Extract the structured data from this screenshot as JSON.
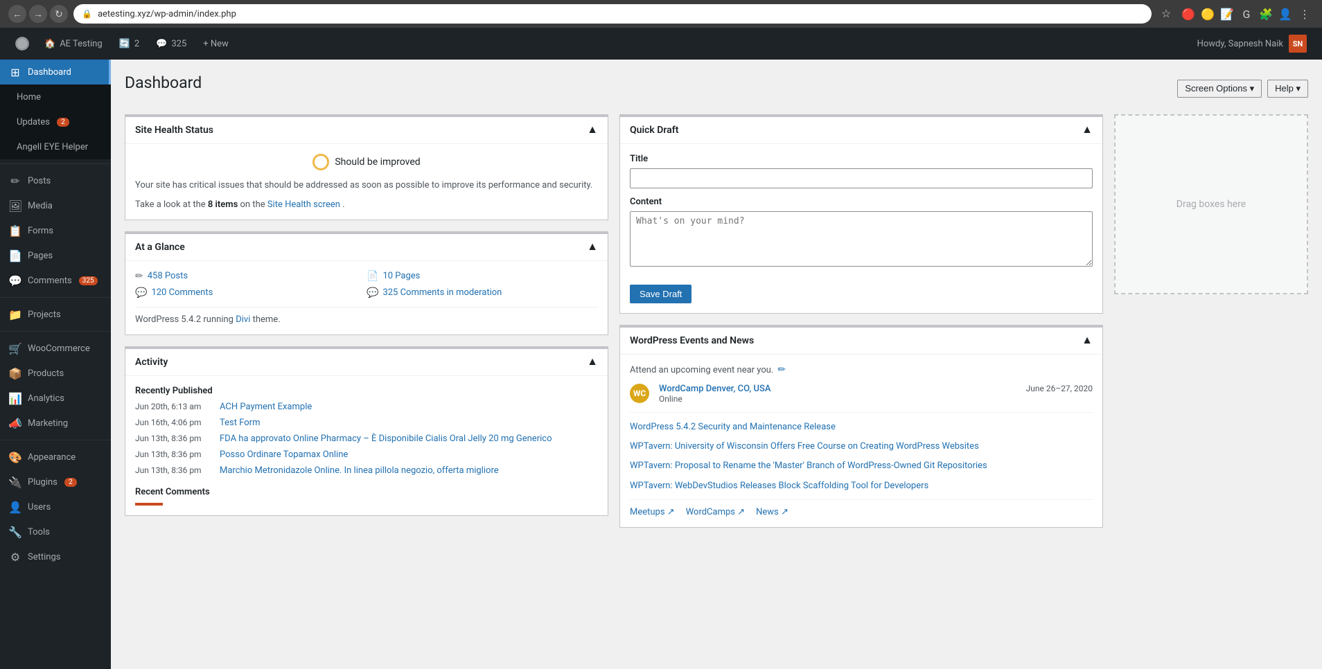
{
  "browser": {
    "url": "aetesting.xyz/wp-admin/index.php",
    "nav_back": "←",
    "nav_fwd": "→",
    "nav_refresh": "↻"
  },
  "admin_bar": {
    "wp_logo": "W",
    "site_name": "AE Testing",
    "comments_label": "Comments",
    "comments_count": "325",
    "new_label": "+ New",
    "howdy": "Howdy, Sapnesh Naik",
    "updates_count": "2"
  },
  "sidebar": {
    "items": [
      {
        "id": "dashboard",
        "label": "Dashboard",
        "icon": "⊞",
        "active": true
      },
      {
        "id": "home",
        "label": "Home",
        "sub": true
      },
      {
        "id": "updates",
        "label": "Updates",
        "sub": true,
        "badge": "2"
      },
      {
        "id": "angell",
        "label": "Angell EYE Helper",
        "sub": true
      },
      {
        "id": "posts",
        "label": "Posts",
        "icon": "✏"
      },
      {
        "id": "media",
        "label": "Media",
        "icon": "🖼"
      },
      {
        "id": "forms",
        "label": "Forms",
        "icon": "📋"
      },
      {
        "id": "pages",
        "label": "Pages",
        "icon": "📄"
      },
      {
        "id": "comments",
        "label": "Comments",
        "icon": "💬",
        "badge": "325"
      },
      {
        "id": "projects",
        "label": "Projects",
        "icon": "📁"
      },
      {
        "id": "woocommerce",
        "label": "WooCommerce",
        "icon": "🛒"
      },
      {
        "id": "products",
        "label": "Products",
        "icon": "📦"
      },
      {
        "id": "analytics",
        "label": "Analytics",
        "icon": "📊"
      },
      {
        "id": "marketing",
        "label": "Marketing",
        "icon": "📣"
      },
      {
        "id": "appearance",
        "label": "Appearance",
        "icon": "🎨"
      },
      {
        "id": "plugins",
        "label": "Plugins",
        "icon": "🔌",
        "badge": "2"
      },
      {
        "id": "users",
        "label": "Users",
        "icon": "👤"
      },
      {
        "id": "tools",
        "label": "Tools",
        "icon": "🔧"
      },
      {
        "id": "settings",
        "label": "Settings",
        "icon": "⚙"
      }
    ]
  },
  "page_title": "Dashboard",
  "screen_options_label": "Screen Options ▾",
  "help_label": "Help ▾",
  "site_health": {
    "title": "Site Health Status",
    "status": "Should be improved",
    "description": "Your site has critical issues that should be addressed as soon as possible to improve its performance and security.",
    "items_text_pre": "Take a look at the",
    "items_count": "8 items",
    "items_text_mid": "on the",
    "items_link": "Site Health screen",
    "items_text_post": "."
  },
  "at_glance": {
    "title": "At a Glance",
    "posts_count": "458 Posts",
    "pages_count": "10 Pages",
    "comments_count": "120 Comments",
    "comments_mod_count": "325 Comments in moderation",
    "wp_version": "WordPress 5.4.2 running",
    "theme_link": "Divi",
    "theme_text": "theme."
  },
  "activity": {
    "title": "Activity",
    "recently_published": "Recently Published",
    "items": [
      {
        "date": "Jun 20th, 6:13 am",
        "title": "ACH Payment Example"
      },
      {
        "date": "Jun 16th, 4:06 pm",
        "title": "Test Form"
      },
      {
        "date": "Jun 13th, 8:36 pm",
        "title": "FDA ha approvato Online Pharmacy – È Disponibile Cialis Oral Jelly 20 mg Generico"
      },
      {
        "date": "Jun 13th, 8:36 pm",
        "title": "Posso Ordinare Topamax Online"
      },
      {
        "date": "Jun 13th, 8:36 pm",
        "title": "Marchio Metronidazole Online. In linea pillola negozio, offerta migliore"
      }
    ],
    "recent_comments": "Recent Comments"
  },
  "quick_draft": {
    "title": "Quick Draft",
    "title_label": "Title",
    "title_placeholder": "",
    "content_label": "Content",
    "content_placeholder": "What's on your mind?",
    "save_button": "Save Draft"
  },
  "wp_events": {
    "title": "WordPress Events and News",
    "attend_text": "Attend an upcoming event near you.",
    "event_name": "WordCamp Denver, CO, USA",
    "event_date": "June 26–27, 2020",
    "event_sub": "Online",
    "news": [
      "WordPress 5.4.2 Security and Maintenance Release",
      "WPTavern: University of Wisconsin Offers Free Course on Creating WordPress Websites",
      "WPTavern: Proposal to Rename the 'Master' Branch of WordPress-Owned Git Repositories",
      "WPTavern: WebDevStudios Releases Block Scaffolding Tool for Developers"
    ],
    "footer_links": [
      {
        "label": "Meetups",
        "icon": "↗"
      },
      {
        "label": "WordCamps",
        "icon": "↗"
      },
      {
        "label": "News",
        "icon": "↗"
      }
    ]
  },
  "drag_boxes": {
    "placeholder": "Drag boxes here"
  }
}
